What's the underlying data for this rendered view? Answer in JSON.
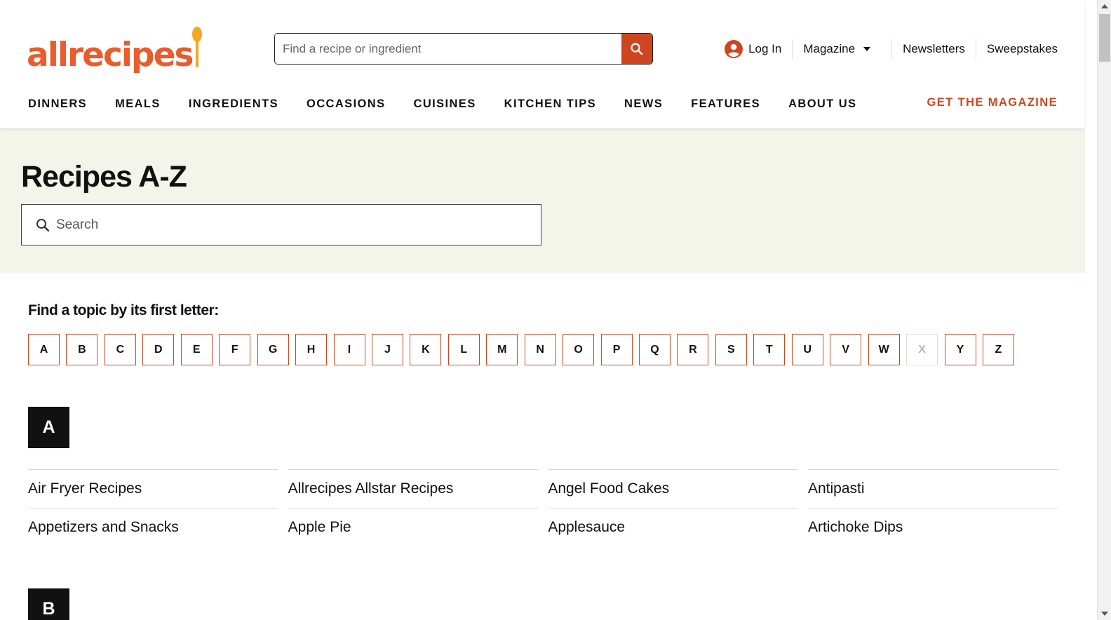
{
  "header": {
    "logo_text": "allrecipes",
    "search_placeholder": "Find a recipe or ingredient",
    "utility": {
      "login": "Log In",
      "magazine": "Magazine",
      "newsletters": "Newsletters",
      "sweepstakes": "Sweepstakes"
    },
    "nav": [
      "DINNERS",
      "MEALS",
      "INGREDIENTS",
      "OCCASIONS",
      "CUISINES",
      "KITCHEN TIPS",
      "NEWS",
      "FEATURES",
      "ABOUT US"
    ],
    "nav_cta": "GET THE MAGAZINE"
  },
  "hero": {
    "title": "Recipes A-Z",
    "search_placeholder": "Search"
  },
  "letters": {
    "heading": "Find a topic by its first letter:",
    "items": [
      {
        "letter": "A",
        "enabled": true
      },
      {
        "letter": "B",
        "enabled": true
      },
      {
        "letter": "C",
        "enabled": true
      },
      {
        "letter": "D",
        "enabled": true
      },
      {
        "letter": "E",
        "enabled": true
      },
      {
        "letter": "F",
        "enabled": true
      },
      {
        "letter": "G",
        "enabled": true
      },
      {
        "letter": "H",
        "enabled": true
      },
      {
        "letter": "I",
        "enabled": true
      },
      {
        "letter": "J",
        "enabled": true
      },
      {
        "letter": "K",
        "enabled": true
      },
      {
        "letter": "L",
        "enabled": true
      },
      {
        "letter": "M",
        "enabled": true
      },
      {
        "letter": "N",
        "enabled": true
      },
      {
        "letter": "O",
        "enabled": true
      },
      {
        "letter": "P",
        "enabled": true
      },
      {
        "letter": "Q",
        "enabled": true
      },
      {
        "letter": "R",
        "enabled": true
      },
      {
        "letter": "S",
        "enabled": true
      },
      {
        "letter": "T",
        "enabled": true
      },
      {
        "letter": "U",
        "enabled": true
      },
      {
        "letter": "V",
        "enabled": true
      },
      {
        "letter": "W",
        "enabled": true
      },
      {
        "letter": "X",
        "enabled": false
      },
      {
        "letter": "Y",
        "enabled": true
      },
      {
        "letter": "Z",
        "enabled": true
      }
    ]
  },
  "sections": [
    {
      "letter": "A",
      "items": [
        "Air Fryer Recipes",
        "Allrecipes Allstar Recipes",
        "Angel Food Cakes",
        "Antipasti",
        "Appetizers and Snacks",
        "Apple Pie",
        "Applesauce",
        "Artichoke Dips"
      ]
    },
    {
      "letter": "B",
      "items": []
    }
  ],
  "colors": {
    "brand_orange": "#ea5c2c",
    "accent": "#ce4620",
    "hero_bg": "#f3f4ea"
  }
}
